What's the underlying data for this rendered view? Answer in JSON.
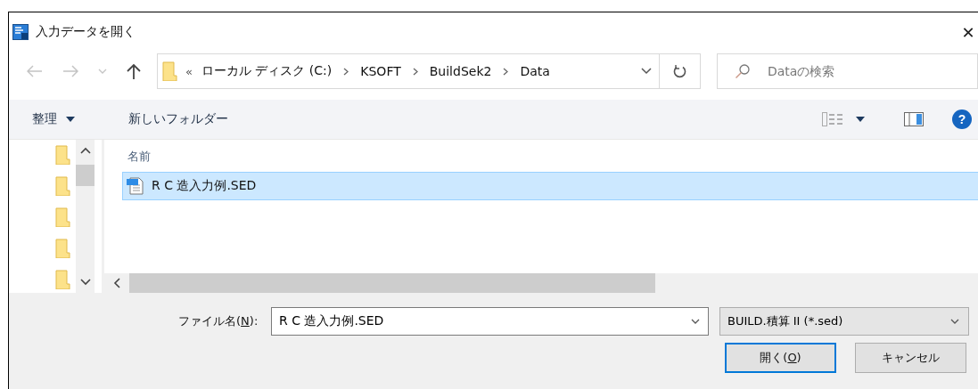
{
  "window": {
    "title": "入力データを開く",
    "close": "✕"
  },
  "address_bar": {
    "overflow": "«",
    "crumbs": [
      "ローカル ディスク (C:)",
      "KSOFT",
      "BuildSek2",
      "Data"
    ]
  },
  "search": {
    "placeholder": "Dataの検索"
  },
  "toolbar": {
    "organize": "整理",
    "new_folder": "新しいフォルダー",
    "help": "?"
  },
  "nav_pane": {
    "items": [
      {
        "kind": "folder"
      },
      {
        "kind": "folder"
      },
      {
        "kind": "folder"
      },
      {
        "kind": "folder"
      },
      {
        "kind": "folder"
      }
    ]
  },
  "file_list": {
    "columns": [
      "名前"
    ],
    "rows": [
      {
        "name": "R C 造入力例.SED",
        "selected": true
      }
    ]
  },
  "file_name": {
    "label_before": "ファイル名(",
    "access_key": "N",
    "label_after": "):",
    "value": "R C 造入力例.SED"
  },
  "file_type": {
    "value": "BUILD.積算 II (*.sed)"
  },
  "buttons": [
    {
      "kind": "default",
      "before": "開く(",
      "access_key": "O",
      "after": ")"
    },
    {
      "kind": "normal",
      "before": "キャンセル"
    }
  ]
}
